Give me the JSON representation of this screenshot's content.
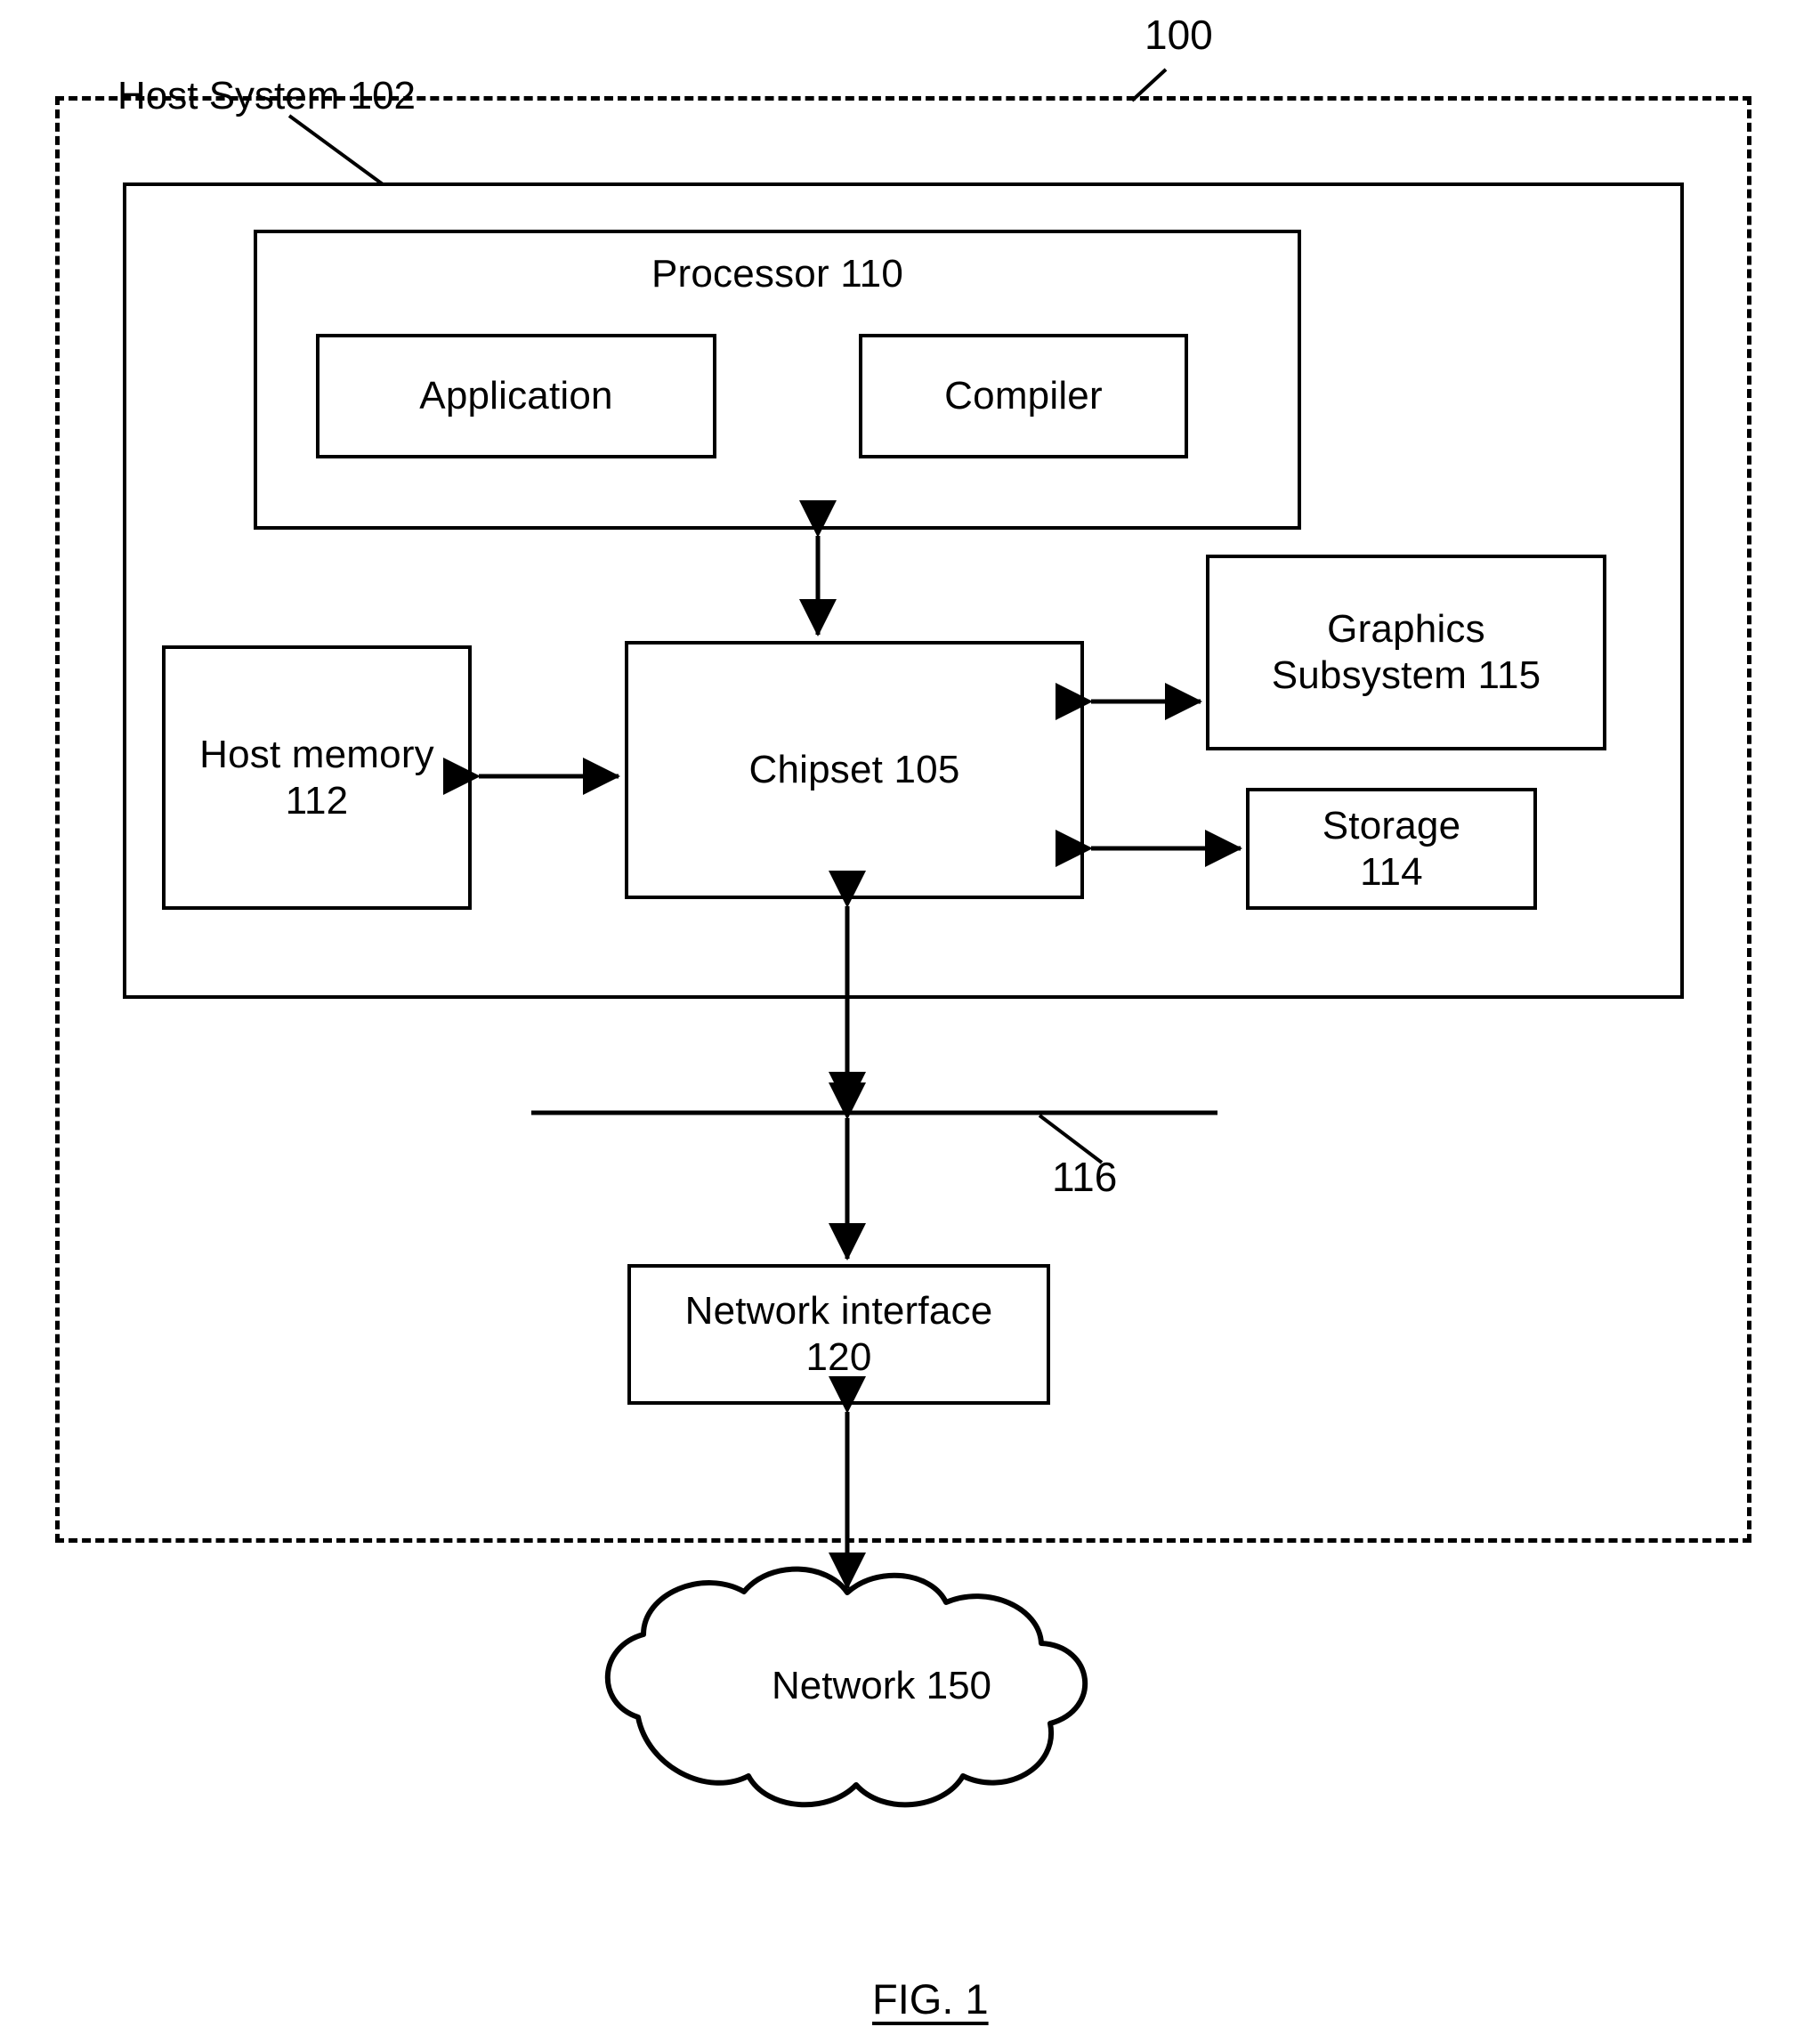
{
  "figure": {
    "caption": "FIG. 1",
    "system_ref": "100"
  },
  "boundary": {
    "system_label": "Host System 102",
    "outer_ref": "100"
  },
  "blocks": {
    "processor": {
      "label": "Processor 110"
    },
    "application": {
      "label": "Application"
    },
    "compiler": {
      "label": "Compiler"
    },
    "chipset": {
      "label": "Chipset 105"
    },
    "host_memory": {
      "label": "Host memory\n112"
    },
    "graphics_subsystem": {
      "label": "Graphics\nSubsystem 115"
    },
    "storage": {
      "label": "Storage\n114"
    },
    "network_interface": {
      "label": "Network interface\n120"
    },
    "network_cloud": {
      "label": "Network 150"
    }
  },
  "connectors": {
    "bus_ref": "116",
    "items": [
      {
        "name": "processor-to-chipset",
        "kind": "double-arrow-vertical"
      },
      {
        "name": "host-memory-to-chipset",
        "kind": "double-arrow-horizontal"
      },
      {
        "name": "chipset-to-graphics-subsystem",
        "kind": "double-arrow-horizontal"
      },
      {
        "name": "chipset-to-storage",
        "kind": "double-arrow-horizontal"
      },
      {
        "name": "chipset-to-bus",
        "kind": "double-arrow-vertical"
      },
      {
        "name": "bus-to-network-interface",
        "kind": "double-arrow-vertical"
      },
      {
        "name": "network-interface-to-network",
        "kind": "double-arrow-vertical"
      }
    ]
  },
  "style": {
    "line_color": "#000000",
    "background": "#ffffff"
  }
}
